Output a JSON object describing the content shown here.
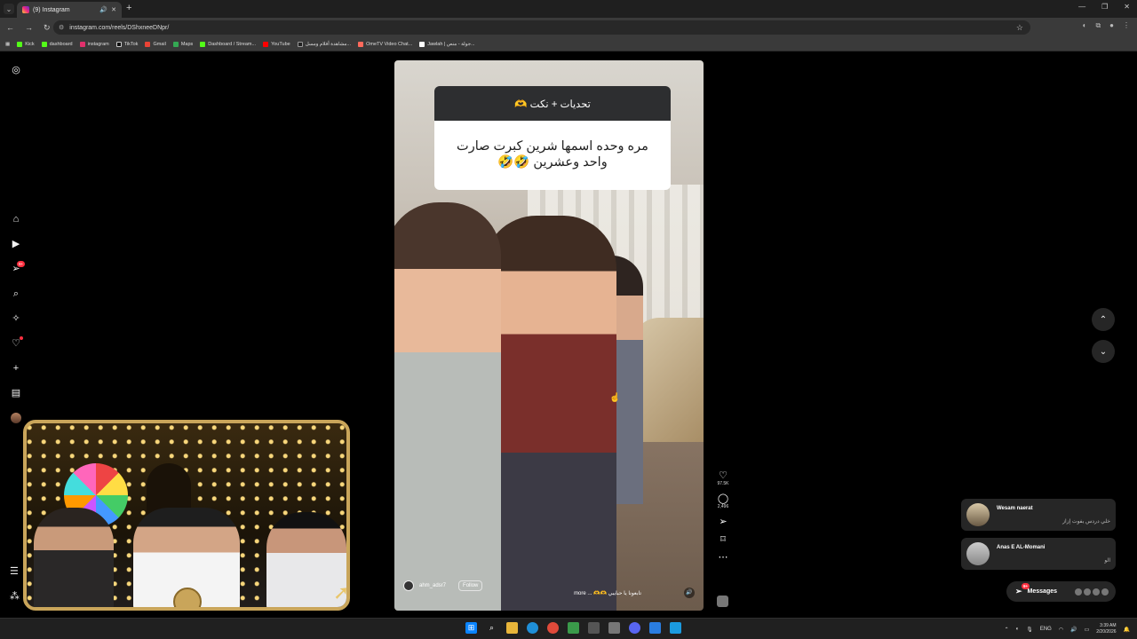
{
  "browser": {
    "tab_title": "(9) Instagram",
    "url": "instagram.com/reels/DShxneeDNpr/",
    "bookmarks": [
      "Kick",
      "dashboard",
      "instagram",
      "TikTok",
      "Gmail",
      "Maps",
      "Dashboard / Stream...",
      "YouTube",
      "مشاهدة أفلام ومسل...",
      "OmeTV Video Chat...",
      "Jawlah | جولة - منص..."
    ]
  },
  "sidebar": {
    "notification_badge": "9+"
  },
  "reel": {
    "caption_header": "تحديات + نكت 🫶",
    "caption_text_line1": "مره وحده اسمها شرين كبرت صارت",
    "caption_text_line2": "واحد وعشرين 🤣🤣",
    "username": "ahm_adsr7",
    "follow_label": "Follow",
    "description": "تابعونا يا حبايبي 🫶🫶 ... more",
    "likes": "97.5K",
    "comments": "2,496"
  },
  "messages": {
    "threads": [
      {
        "name": "Wesam naerat",
        "preview": "خلي دردس يفوت إزاز"
      },
      {
        "name": "Anas E AL-Momani",
        "preview": "الو"
      }
    ],
    "pill_label": "Messages",
    "pill_badge": "9+"
  },
  "taskbar": {
    "lang": "ENG",
    "time": "3:39 AM",
    "date": "2/20/2026"
  }
}
